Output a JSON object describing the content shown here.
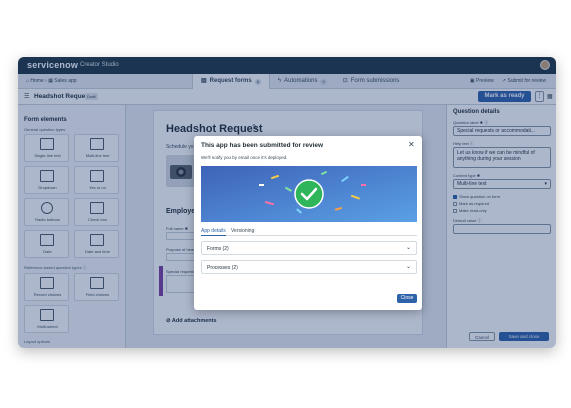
{
  "topbar": {
    "brand": "servicenow",
    "studio": "Creator Studio"
  },
  "navbar": {
    "breadcrumb": "⌂ Home  ›  ▦ Sales app",
    "tabs": [
      {
        "label": "Request forms",
        "count": "1"
      },
      {
        "label": "Automations",
        "count": "0"
      },
      {
        "label": "Form submissions",
        "count": ""
      }
    ],
    "preview": "▣ Preview",
    "submit": "↗ Submit for review"
  },
  "toolbar": {
    "title": "Headshot Request",
    "status": "Draft",
    "review_label": "Mark as ready",
    "more": "⋮"
  },
  "sidebar": {
    "heading": "Form elements",
    "general_label": "General question types",
    "general_tiles": [
      "Single-line text",
      "Multi-line text",
      "Dropdown",
      "Yes or no",
      "Radio buttons",
      "Check box",
      "Date",
      "Date and time"
    ],
    "reference_label": "Reference-based question types ⓘ",
    "reference_tiles": [
      "Record choices",
      "Field choices",
      "Multi-select"
    ],
    "layout_label": "Layout options"
  },
  "form": {
    "title": "Headshot Request",
    "description": "Schedule yo",
    "employee_heading": "Employee",
    "fields": [
      "Full name ✱",
      "Purpose of headsh",
      "Special requests"
    ],
    "attachments": "⊘ Add attachments"
  },
  "right_panel": {
    "heading": "Question details",
    "question_label": "Question label ✱ ⓘ",
    "question_value": "Special requests or accommodati...",
    "help_label": "Help text ⓘ",
    "help_value": "Let us know if we can be mindful of anything during your session",
    "content_label": "Content type ✱",
    "content_value": "Multi-line text",
    "checks": [
      "Show question on form",
      "Mark as required",
      "Make read-only"
    ],
    "default_label": "Default value ⓘ",
    "cancel": "Cancel",
    "save": "Save and close"
  },
  "modal": {
    "title": "This app has been submitted for review",
    "subtitle": "We'll notify you by email once it's deployed.",
    "tabs": [
      "App details",
      "Versioning"
    ],
    "sections": [
      "Forms (2)",
      "Processes (2)"
    ],
    "close_label": "Close",
    "hero_bg": "#4a73c9",
    "check_color": "#2fb55a"
  }
}
